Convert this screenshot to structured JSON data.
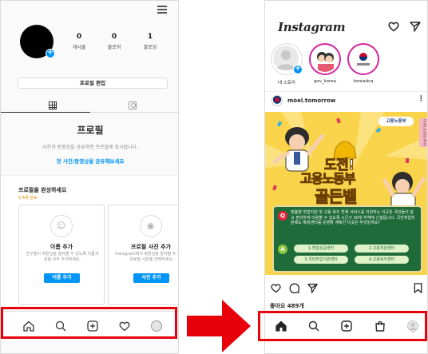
{
  "left": {
    "stats": [
      {
        "num": "0",
        "label": "게시물"
      },
      {
        "num": "0",
        "label": "팔로워"
      },
      {
        "num": "1",
        "label": "팔로잉"
      }
    ],
    "edit_profile": "프로필 편집",
    "empty_title": "프로필",
    "empty_desc": "사진과 동영상을 공유하면 프로필에 표시됩니다.",
    "empty_link": "첫 사진/동영상을 공유해보세요",
    "complete_title": "프로필을 완성하세요",
    "complete_progress": "1/4개 완료",
    "cards": [
      {
        "title": "이름 추가",
        "desc": "친구들이 회원님을 알아볼 수 있도록 이름과 성을 모두 추가하세요.",
        "button": "이름 추가",
        "icon": "id-icon"
      },
      {
        "title": "프로필 사진 추가",
        "desc": "Instagram에서 회원님을 알아볼 수 있도록 프로필 사진을 선택하세요.",
        "button": "사진 추가",
        "icon": "camera-icon"
      }
    ],
    "nav": [
      "home-icon",
      "search-icon",
      "create-icon",
      "heart-icon",
      "profile-avatar"
    ]
  },
  "right": {
    "brand": "Instagram",
    "stories": [
      {
        "label": "내 스토리"
      },
      {
        "label": "gov_korea"
      },
      {
        "label": "koreadca"
      }
    ],
    "post": {
      "user": "moel.tomorrow",
      "badge": "고용노동부",
      "headline1": "도전!",
      "headline2": "고용노동부",
      "headline3": "골든벨",
      "question_mark": "Q",
      "question": "맞춤형 취업지원 및 고용·복지 연계 서비스를 지원하는 이곳은 국민들이 쉽고 편리하게 이용할 수 있도록 시군구 30개 지역에 신설됩니다. 국민취업지원제도 확장센터를 운영할 계획인 이곳은 무엇일까요?",
      "answer_mark": "A",
      "answers": [
        "1.취업성공센터",
        "2.고용지원센터",
        "3.국민취업지원센터",
        "4.고용복지센터"
      ],
      "side_tab": "고용노동부 퀴즈"
    },
    "likes": "좋아요 489개",
    "nav": [
      "home-icon",
      "search-icon",
      "create-icon",
      "shop-icon",
      "profile-avatar"
    ]
  },
  "colors": {
    "highlight": "#e8000b",
    "link": "#0095f6",
    "quiz_green": "#1f6b3a",
    "quiz_yellow": "#f9d44a"
  }
}
